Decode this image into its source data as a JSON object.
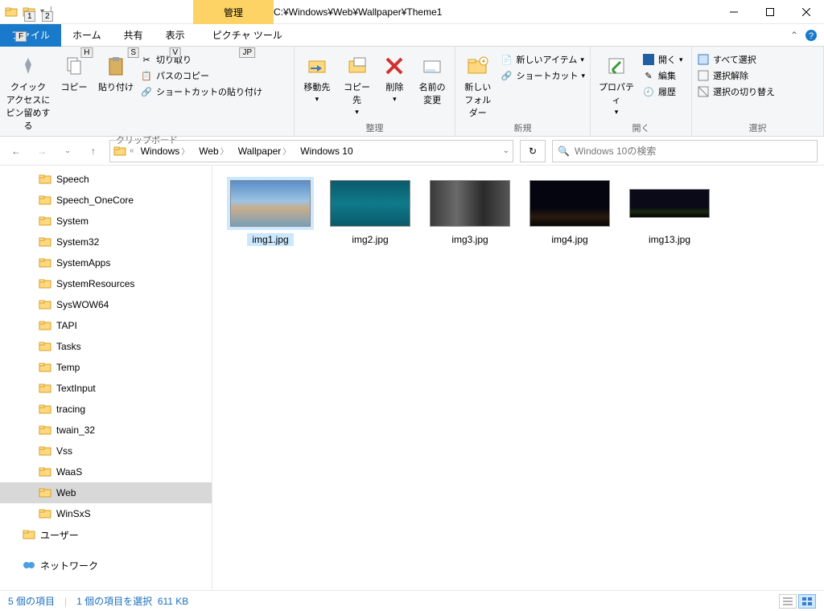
{
  "title_path": "C:¥Windows¥Web¥Wallpaper¥Theme1",
  "context_tab": "管理",
  "tabs": {
    "file": "ファイル",
    "home": "ホーム",
    "share": "共有",
    "view": "表示",
    "picture": "ピクチャ ツール"
  },
  "keytips": {
    "file": "F",
    "home": "H",
    "share": "S",
    "view": "V",
    "picture": "JP",
    "qat1": "1",
    "qat2": "2"
  },
  "ribbon": {
    "pin": "クイック アクセスにピン留めする",
    "copy": "コピー",
    "paste": "貼り付け",
    "cut": "切り取り",
    "copypath": "パスのコピー",
    "pasteshortcut": "ショートカットの貼り付け",
    "clipboard": "クリップボード",
    "moveto": "移動先",
    "copyto": "コピー先",
    "delete": "削除",
    "rename": "名前の変更",
    "organize": "整理",
    "newfolder": "新しいフォルダー",
    "newitem": "新しいアイテム",
    "shortcut": "ショートカット",
    "new": "新規",
    "properties": "プロパティ",
    "open": "開く",
    "edit": "編集",
    "history": "履歴",
    "open_group": "開く",
    "selectall": "すべて選択",
    "selectnone": "選択解除",
    "invert": "選択の切り替え",
    "select": "選択"
  },
  "breadcrumbs": [
    "Windows",
    "Web",
    "Wallpaper",
    "Windows 10"
  ],
  "search_placeholder": "Windows 10の検索",
  "tree": [
    {
      "label": "Speech",
      "depth": 1
    },
    {
      "label": "Speech_OneCore",
      "depth": 1
    },
    {
      "label": "System",
      "depth": 1
    },
    {
      "label": "System32",
      "depth": 1
    },
    {
      "label": "SystemApps",
      "depth": 1
    },
    {
      "label": "SystemResources",
      "depth": 1
    },
    {
      "label": "SysWOW64",
      "depth": 1
    },
    {
      "label": "TAPI",
      "depth": 1
    },
    {
      "label": "Tasks",
      "depth": 1
    },
    {
      "label": "Temp",
      "depth": 1
    },
    {
      "label": "TextInput",
      "depth": 1
    },
    {
      "label": "tracing",
      "depth": 1
    },
    {
      "label": "twain_32",
      "depth": 1
    },
    {
      "label": "Vss",
      "depth": 1
    },
    {
      "label": "WaaS",
      "depth": 1
    },
    {
      "label": "Web",
      "depth": 1,
      "selected": true
    },
    {
      "label": "WinSxS",
      "depth": 1
    },
    {
      "label": "ユーザー",
      "depth": 0
    },
    {
      "label": "ネットワーク",
      "depth": 0,
      "network": true
    }
  ],
  "files": [
    {
      "name": "img1.jpg",
      "selected": true,
      "bg": "linear-gradient(to bottom,#5a8ec8 0%,#9cc3e3 45%,#c9ad8a 60%,#7a9fb8 100%)"
    },
    {
      "name": "img2.jpg",
      "selected": false,
      "bg": "linear-gradient(to bottom,#0a5a6a,#0f7a8a,#0a5a6a)"
    },
    {
      "name": "img3.jpg",
      "selected": false,
      "bg": "linear-gradient(to right,#3a3a3a,#6a6a6a,#2a2a2a,#565656)"
    },
    {
      "name": "img4.jpg",
      "selected": false,
      "bg": "linear-gradient(to bottom,#050510 60%,#2a1a10 80%,#050505)"
    },
    {
      "name": "img13.jpg",
      "selected": false,
      "bg": "linear-gradient(to bottom,#0a0a18 65%,#1a2a10 80%,#050505)",
      "small": true
    }
  ],
  "status": {
    "count": "5 個の項目",
    "selected": "1 個の項目を選択",
    "size": "611 KB"
  }
}
